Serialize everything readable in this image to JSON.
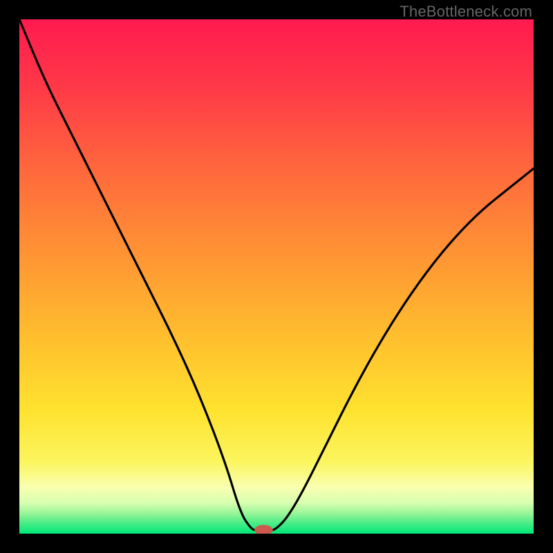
{
  "watermark": "TheBottleneck.com",
  "chart_data": {
    "type": "line",
    "title": "",
    "xlabel": "",
    "ylabel": "",
    "xlim": [
      0,
      100
    ],
    "ylim": [
      0,
      100
    ],
    "background_gradient_top": "#ff1a4f",
    "background_gradient_mid": "#ffd633",
    "background_green_band_top": "#f9ffb0",
    "background_green_band_bottom": "#00e878",
    "curve_color": "#000000",
    "series": [
      {
        "name": "left-branch",
        "x": [
          0,
          5,
          10,
          15,
          20,
          25,
          30,
          35,
          40,
          43,
          45,
          46
        ],
        "y": [
          100,
          88,
          78,
          68,
          58,
          48,
          38,
          27,
          14,
          4,
          1,
          0.6
        ]
      },
      {
        "name": "right-branch",
        "x": [
          49,
          50,
          52,
          55,
          60,
          65,
          70,
          75,
          80,
          85,
          90,
          95,
          100
        ],
        "y": [
          0.6,
          1,
          3,
          8,
          18,
          28,
          37,
          45,
          52,
          58,
          63,
          67,
          71
        ]
      },
      {
        "name": "valley-floor",
        "x": [
          46,
          49
        ],
        "y": [
          0.6,
          0.6
        ]
      }
    ],
    "marker": {
      "x": 47.5,
      "y": 0.7,
      "rx": 1.8,
      "ry": 1.0,
      "fill": "#cc5a4d"
    }
  }
}
